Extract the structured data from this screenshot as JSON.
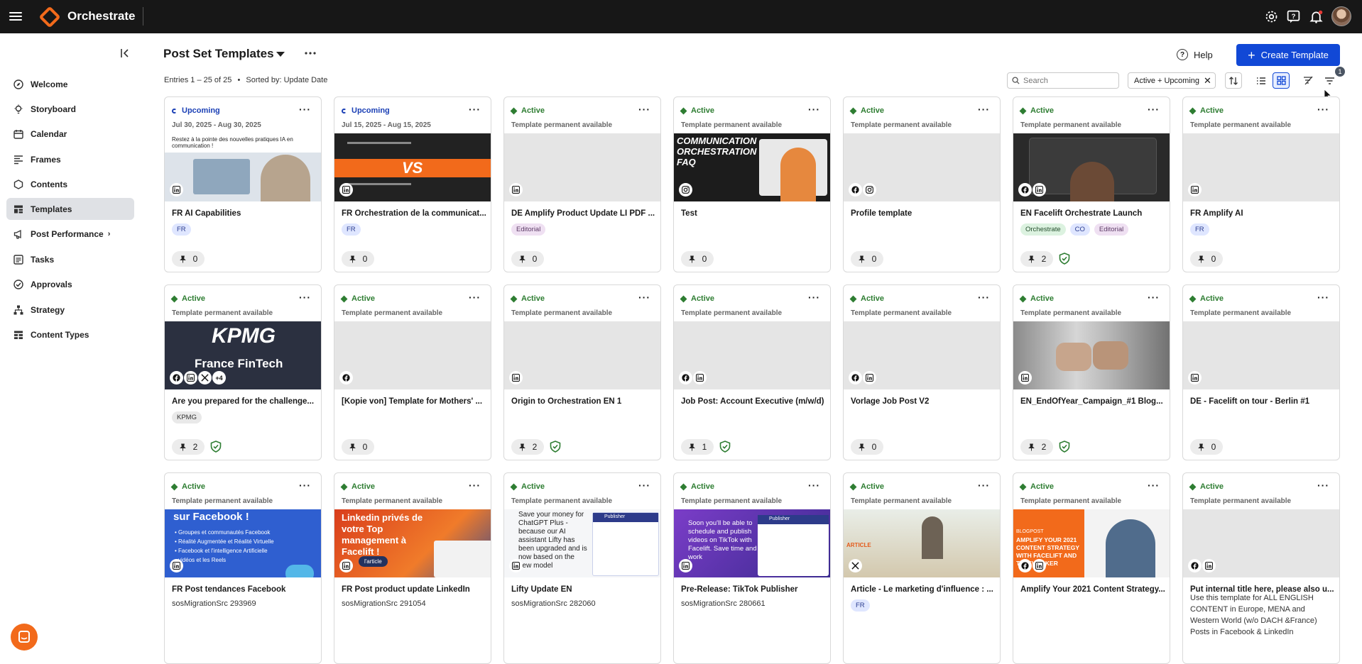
{
  "app": {
    "name": "Orchestrate"
  },
  "sidebar": {
    "items": [
      {
        "label": "Welcome",
        "icon": "compass-icon"
      },
      {
        "label": "Storyboard",
        "icon": "lightbulb-icon"
      },
      {
        "label": "Calendar",
        "icon": "calendar-icon"
      },
      {
        "label": "Frames",
        "icon": "lines-icon"
      },
      {
        "label": "Contents",
        "icon": "hexagon-icon"
      },
      {
        "label": "Templates",
        "icon": "template-icon",
        "selected": true
      },
      {
        "label": "Post Performance",
        "icon": "megaphone-icon",
        "chevron": "›"
      },
      {
        "label": "Tasks",
        "icon": "tasks-icon"
      },
      {
        "label": "Approvals",
        "icon": "check-circle-icon"
      },
      {
        "label": "Strategy",
        "icon": "hierarchy-icon"
      },
      {
        "label": "Content Types",
        "icon": "content-types-icon"
      }
    ]
  },
  "header": {
    "title": "Post Set Templates",
    "entries": "Entries 1 – 25 of 25",
    "separator": "•",
    "sorted": "Sorted by: Update Date",
    "help": "Help",
    "create": "Create Template",
    "search_placeholder": "Search",
    "filter_chip": "Active + Upcoming",
    "filter_badge": "1"
  },
  "colors": {
    "accent": "#1148d6",
    "active": "#2e7d32",
    "upcoming": "#1a3fb5",
    "brand": "#f26a1b"
  },
  "cards": [
    {
      "status": "Upcoming",
      "sub": "Jul 30, 2025 - Aug 30, 2025",
      "title": "FR AI Capabilities",
      "tags": [
        {
          "t": "FR",
          "c": "blue"
        }
      ],
      "pins": "0",
      "platforms": [
        "in"
      ],
      "thumb": "ai"
    },
    {
      "status": "Upcoming",
      "sub": "Jul 15, 2025 - Aug 15, 2025",
      "title": "FR Orchestration de la communicat...",
      "tags": [
        {
          "t": "FR",
          "c": "blue"
        }
      ],
      "pins": "0",
      "platforms": [
        "in"
      ],
      "thumb": "vs"
    },
    {
      "status": "Active",
      "sub": "Template permanent available",
      "title": "DE Amplify Product Update LI PDF ...",
      "tags": [
        {
          "t": "Editorial",
          "c": "purple"
        }
      ],
      "pins": "0",
      "platforms": [
        "in"
      ],
      "thumb": "none"
    },
    {
      "status": "Active",
      "sub": "Template permanent available",
      "title": "Test",
      "tags": [],
      "pins": "0",
      "platforms": [
        "ig"
      ],
      "thumb": "comm",
      "thumb_text": "COMMUNICATION ORCHESTRATION FAQ"
    },
    {
      "status": "Active",
      "sub": "Template permanent available",
      "title": "Profile template",
      "tags": [],
      "pins": "0",
      "platforms": [
        "fb",
        "ig"
      ],
      "thumb": "none"
    },
    {
      "status": "Active",
      "sub": "Template permanent available",
      "title": "EN Facelift Orchestrate Launch",
      "tags": [
        {
          "t": "Orchestrate",
          "c": "green"
        },
        {
          "t": "CO",
          "c": "blue"
        },
        {
          "t": "Editorial",
          "c": "purple"
        }
      ],
      "pins": "2",
      "approved": true,
      "platforms": [
        "fb",
        "in"
      ],
      "thumb": "dark"
    },
    {
      "status": "Active",
      "sub": "Template permanent available",
      "title": "FR Amplify AI",
      "tags": [
        {
          "t": "FR",
          "c": "blue"
        }
      ],
      "pins": "0",
      "platforms": [
        "in"
      ],
      "thumb": "none"
    },
    {
      "status": "Active",
      "sub": "Template permanent available",
      "title": "Are you prepared for the challenge...",
      "tags": [
        {
          "t": "KPMG",
          "c": "gray"
        }
      ],
      "pins": "2",
      "approved": true,
      "platforms": [
        "fb",
        "in",
        "x"
      ],
      "more_platforms": "+4",
      "thumb": "kpmg",
      "thumb_text": "KPMG",
      "thumb_text2": "France FinTech"
    },
    {
      "status": "Active",
      "sub": "Template permanent available",
      "title": "[Kopie von] Template for Mothers' ...",
      "tags": [],
      "pins": "0",
      "platforms": [
        "fb"
      ],
      "thumb": "none"
    },
    {
      "status": "Active",
      "sub": "Template permanent available",
      "title": "Origin to Orchestration EN 1",
      "tags": [],
      "pins": "2",
      "approved": true,
      "platforms": [
        "in"
      ],
      "thumb": "none"
    },
    {
      "status": "Active",
      "sub": "Template permanent available",
      "title": "Job Post: Account Executive (m/w/d)",
      "tags": [],
      "pins": "1",
      "approved": true,
      "platforms": [
        "fb",
        "in"
      ],
      "thumb": "none"
    },
    {
      "status": "Active",
      "sub": "Template permanent available",
      "title": "Vorlage Job Post V2",
      "tags": [],
      "pins": "0",
      "platforms": [
        "fb",
        "in"
      ],
      "thumb": "none"
    },
    {
      "status": "Active",
      "sub": "Template permanent available",
      "title": "EN_EndOfYear_Campaign_#1 Blog...",
      "tags": [],
      "pins": "2",
      "approved": true,
      "platforms": [
        "in"
      ],
      "thumb": "fist"
    },
    {
      "status": "Active",
      "sub": "Template permanent available",
      "title": "DE - Facelift on tour - Berlin #1",
      "tags": [],
      "pins": "0",
      "platforms": [
        "in"
      ],
      "thumb": "none"
    },
    {
      "status": "Active",
      "sub": "Template permanent available",
      "title": "FR Post tendances Facebook",
      "desc": "sosMigrationSrc 293969",
      "platforms": [
        "in"
      ],
      "thumb": "fb",
      "thumb_text": "sur Facebook !"
    },
    {
      "status": "Active",
      "sub": "Template permanent available",
      "title": "FR Post product update LinkedIn",
      "desc": "sosMigrationSrc 291054",
      "platforms": [
        "in"
      ],
      "thumb": "li",
      "thumb_text": "Linkedin privés de votre Top management à Facelift !",
      "thumb_btn": "l'article"
    },
    {
      "status": "Active",
      "sub": "Template permanent available",
      "title": "Lifty Update EN",
      "desc": "sosMigrationSrc 282060",
      "platforms": [
        "in"
      ],
      "thumb": "lifty",
      "thumb_text": "Save your money for ChatGPT Plus - because our AI assistant Lifty has been upgraded and is now based on the new model",
      "thumb_label": "Publisher"
    },
    {
      "status": "Active",
      "sub": "Template permanent available",
      "title": "Pre-Release: TikTok Publisher",
      "desc": "sosMigrationSrc 280661",
      "platforms": [
        "in"
      ],
      "thumb": "tiktok",
      "thumb_text": "Soon you'll be able to schedule and publish videos on TikTok with Facelift. Save time and work",
      "thumb_label": "Publisher"
    },
    {
      "status": "Active",
      "sub": "Template permanent available",
      "title": "Article - Le marketing d'influence : ...",
      "tags": [
        {
          "t": "FR",
          "c": "blue"
        }
      ],
      "platforms": [
        "x"
      ],
      "thumb": "article",
      "thumb_text": "ARTICLE"
    },
    {
      "status": "Active",
      "sub": "Template permanent available",
      "title": "Amplify Your 2021 Content Strategy...",
      "platforms": [
        "fb",
        "in"
      ],
      "thumb": "amplify",
      "thumb_text": "AMPLIFY YOUR 2021 CONTENT STRATEGY WITH FACELIFT AND TALKWALKER",
      "thumb_label": "BLOGPOST"
    },
    {
      "status": "Active",
      "sub": "Template permanent available",
      "title": "Put internal title here, please also u...",
      "desc": "Use this template for ALL ENGLISH CONTENT in Europe, MENA and Western World (w/o DACH &France) Posts in Facebook & LinkedIn",
      "long": true,
      "platforms": [
        "fb",
        "in"
      ],
      "thumb": "none"
    }
  ]
}
